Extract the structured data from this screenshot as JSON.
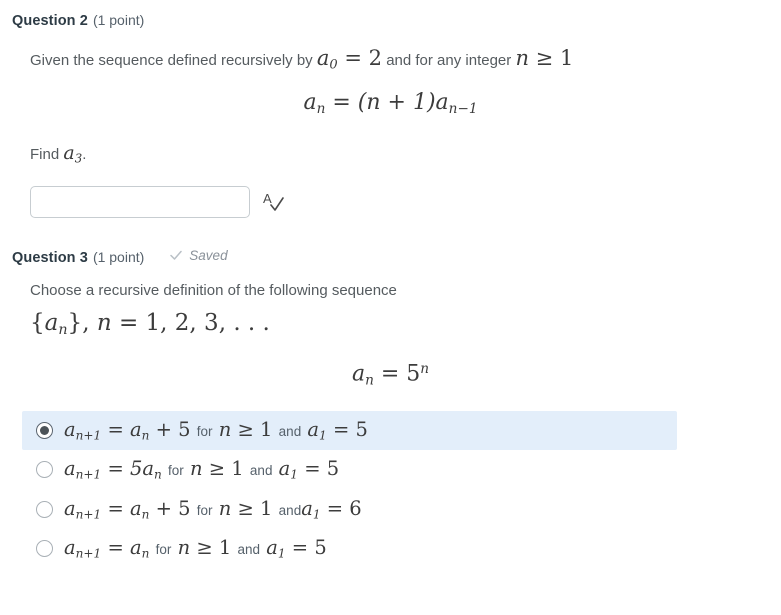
{
  "colors": {
    "selected_choice_background": "#e3eefa",
    "heading_text": "#2d3b45",
    "body_text": "#555b5f",
    "muted_text": "#8a9199",
    "input_border": "#c7cdd1",
    "radio_fill": "#4c5358"
  },
  "question2": {
    "title": "Question 2",
    "points": "(1 point)",
    "prompt_part1": "Given the sequence defined recursively by",
    "prompt_math_a0": "a",
    "prompt_math_a0_sub": "0",
    "prompt_math_eq": "=",
    "prompt_math_val": "2",
    "prompt_part2": "and for any integer",
    "prompt_math_n": "n",
    "prompt_math_geq": "≥",
    "prompt_math_one": "1",
    "display_equation": {
      "lhs_base": "a",
      "lhs_sub": "n",
      "equals": "=",
      "rhs": "(n + 1)a",
      "rhs_sub": "n−1"
    },
    "find_label": "Find",
    "find_math_base": "a",
    "find_math_sub": "3",
    "find_period": ".",
    "answer_input": {
      "value": "",
      "placeholder": ""
    },
    "spellcheck_icon": "spellcheck-icon"
  },
  "question3": {
    "title": "Question 3",
    "points": "(1 point)",
    "status_icon": "check-icon",
    "status_label": "Saved",
    "prompt": "Choose a recursive definition of the following sequence",
    "sequence_notation": {
      "open": "{",
      "base": "a",
      "sub": "n",
      "close": "}",
      "comma": ",",
      "var": "n",
      "equals": "=",
      "list": "1, 2, 3, . . ."
    },
    "display_equation": {
      "lhs_base": "a",
      "lhs_sub": "n",
      "equals": "=",
      "rhs_base": "5",
      "rhs_sup": "n"
    },
    "choices": [
      {
        "selected": true,
        "lhs_base": "a",
        "lhs_sub": "n+1",
        "equals": "=",
        "rhs": "a",
        "rhs_sub": "n",
        "plus": "+ 5",
        "word_for": "for",
        "cond_var": "n",
        "cond_op": "≥",
        "cond_val": "1",
        "word_and": "and",
        "init_base": "a",
        "init_sub": "1",
        "init_eq": "=",
        "init_val": "5"
      },
      {
        "selected": false,
        "lhs_base": "a",
        "lhs_sub": "n+1",
        "equals": "=",
        "rhs": "5a",
        "rhs_sub": "n",
        "plus": "",
        "word_for": "for",
        "cond_var": "n",
        "cond_op": "≥",
        "cond_val": "1",
        "word_and": "and",
        "init_base": "a",
        "init_sub": "1",
        "init_eq": "=",
        "init_val": "5"
      },
      {
        "selected": false,
        "lhs_base": "a",
        "lhs_sub": "n+1",
        "equals": "=",
        "rhs": "a",
        "rhs_sub": "n",
        "plus": "+ 5",
        "word_for": "for",
        "cond_var": "n",
        "cond_op": "≥",
        "cond_val": "1",
        "word_and": "and",
        "init_base": "a",
        "init_sub": "1",
        "init_eq": "=",
        "init_val": "6"
      },
      {
        "selected": false,
        "lhs_base": "a",
        "lhs_sub": "n+1",
        "equals": "=",
        "rhs": "a",
        "rhs_sub": "n",
        "plus": "",
        "word_for": "for",
        "cond_var": "n",
        "cond_op": "≥",
        "cond_val": "1",
        "word_and": "and",
        "init_base": "a",
        "init_sub": "1",
        "init_eq": "=",
        "init_val": "5"
      }
    ]
  }
}
